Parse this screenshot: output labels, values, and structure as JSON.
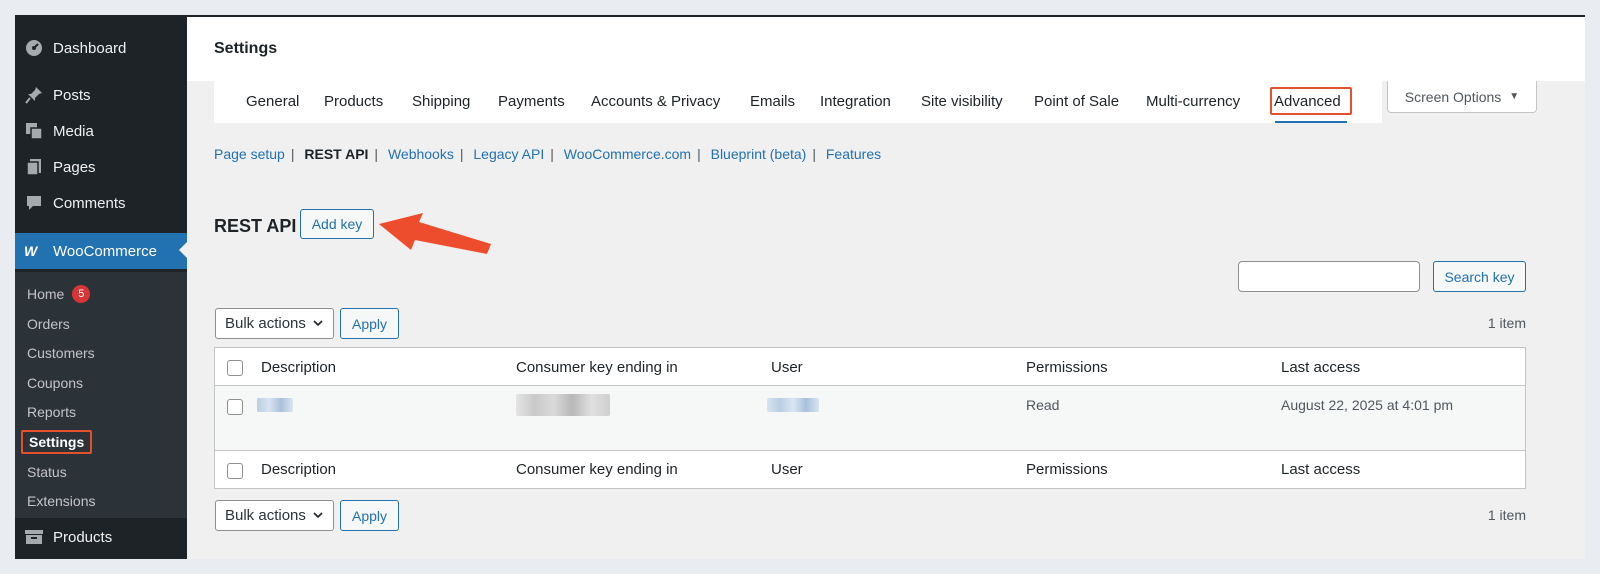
{
  "sidebar": {
    "menu": [
      {
        "label": "Dashboard",
        "icon": "dashboard-icon"
      },
      {
        "label": "Posts",
        "icon": "pin-icon"
      },
      {
        "label": "Media",
        "icon": "media-icon"
      },
      {
        "label": "Pages",
        "icon": "pages-icon"
      },
      {
        "label": "Comments",
        "icon": "comment-icon"
      },
      {
        "label": "WooCommerce",
        "icon": "woocommerce-icon"
      },
      {
        "label": "Products",
        "icon": "archive-icon"
      }
    ],
    "submenu": [
      {
        "label": "Home",
        "badge": "5"
      },
      {
        "label": "Orders"
      },
      {
        "label": "Customers"
      },
      {
        "label": "Coupons"
      },
      {
        "label": "Reports"
      },
      {
        "label": "Settings"
      },
      {
        "label": "Status"
      },
      {
        "label": "Extensions"
      }
    ]
  },
  "header": {
    "title": "Settings"
  },
  "tabs": [
    "General",
    "Products",
    "Shipping",
    "Payments",
    "Accounts & Privacy",
    "Emails",
    "Integration",
    "Site visibility",
    "Point of Sale",
    "Multi-currency",
    "Advanced"
  ],
  "active_tab": "Advanced",
  "screen_options": {
    "label": "Screen Options"
  },
  "subnav": [
    "Page setup",
    "REST API",
    "Webhooks",
    "Legacy API",
    "WooCommerce.com",
    "Blueprint (beta)",
    "Features"
  ],
  "rest": {
    "title": "REST API",
    "add_key": "Add key",
    "search_button": "Search key",
    "search_placeholder": ""
  },
  "bulk": {
    "label": "Bulk actions",
    "apply": "Apply",
    "count": "1 item"
  },
  "table": {
    "columns": [
      "Description",
      "Consumer key ending in",
      "User",
      "Permissions",
      "Last access"
    ],
    "rows": [
      {
        "description": "",
        "consumer_key": "",
        "user": "",
        "permissions": "Read",
        "last_access": "August 22, 2025 at 4:01 pm"
      }
    ]
  },
  "colors": {
    "accent": "#2271b1",
    "highlight": "#e5512d",
    "sidebar": "#1d2327",
    "badge": "#d63638"
  }
}
